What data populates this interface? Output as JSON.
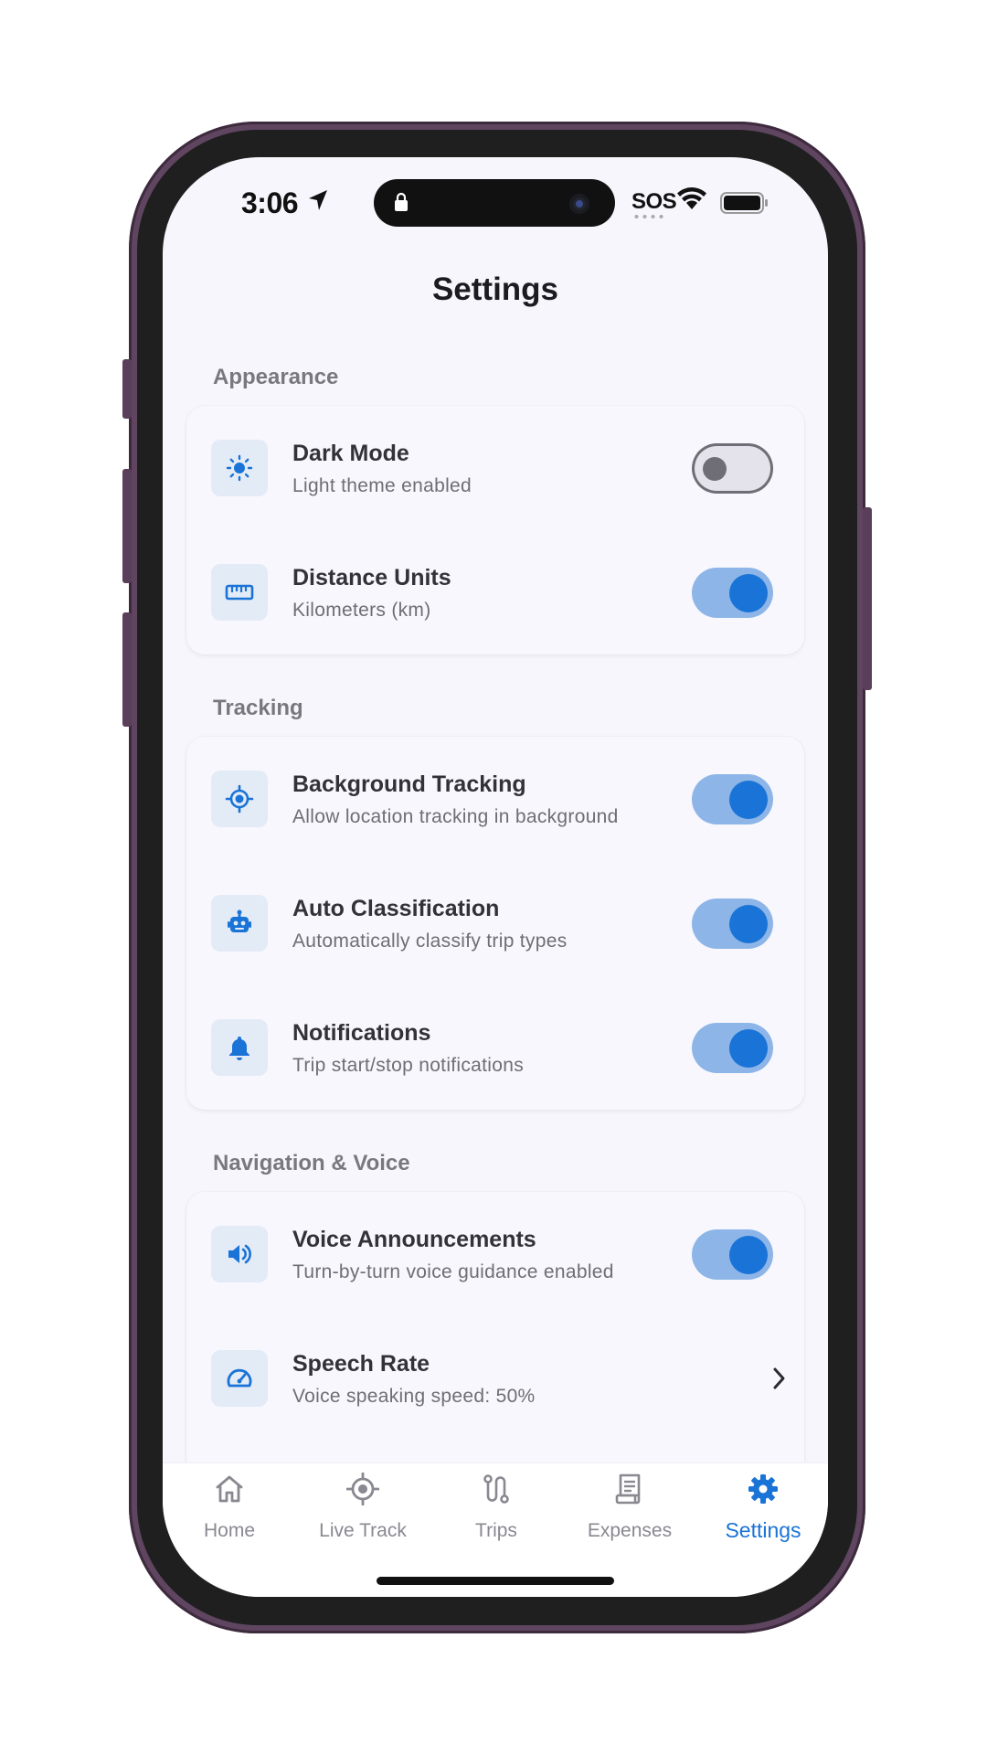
{
  "status_bar": {
    "time": "3:06",
    "carrier": "SOS"
  },
  "page": {
    "title": "Settings"
  },
  "sections": [
    {
      "label": "Appearance",
      "items": [
        {
          "title": "Dark Mode",
          "subtitle": "Light theme enabled",
          "icon": "sun-icon",
          "control": "toggle",
          "on": false
        },
        {
          "title": "Distance Units",
          "subtitle": "Kilometers (km)",
          "icon": "ruler-icon",
          "control": "toggle",
          "on": true
        }
      ]
    },
    {
      "label": "Tracking",
      "items": [
        {
          "title": "Background Tracking",
          "subtitle": "Allow location tracking in background",
          "icon": "gps-target-icon",
          "control": "toggle",
          "on": true
        },
        {
          "title": "Auto Classification",
          "subtitle": "Automatically classify trip types",
          "icon": "robot-icon",
          "control": "toggle",
          "on": true
        },
        {
          "title": "Notifications",
          "subtitle": "Trip start/stop notifications",
          "icon": "bell-icon",
          "control": "toggle",
          "on": true
        }
      ]
    },
    {
      "label": "Navigation & Voice",
      "items": [
        {
          "title": "Voice Announcements",
          "subtitle": "Turn-by-turn voice guidance enabled",
          "icon": "speaker-icon",
          "control": "toggle",
          "on": true
        },
        {
          "title": "Speech Rate",
          "subtitle": "Voice speaking speed: 50%",
          "icon": "speedometer-icon",
          "control": "chevron"
        }
      ]
    }
  ],
  "tabs": [
    {
      "label": "Home",
      "icon": "home-icon",
      "active": false
    },
    {
      "label": "Live Track",
      "icon": "gps-target-icon",
      "active": false
    },
    {
      "label": "Trips",
      "icon": "route-icon",
      "active": false
    },
    {
      "label": "Expenses",
      "icon": "receipt-icon",
      "active": false
    },
    {
      "label": "Settings",
      "icon": "gear-icon",
      "active": true
    }
  ],
  "colors": {
    "accent": "#1a73d6",
    "toggle_track_on": "#8db5e8",
    "icon_bg": "#e3ebf7",
    "background": "#f7f6fd"
  }
}
